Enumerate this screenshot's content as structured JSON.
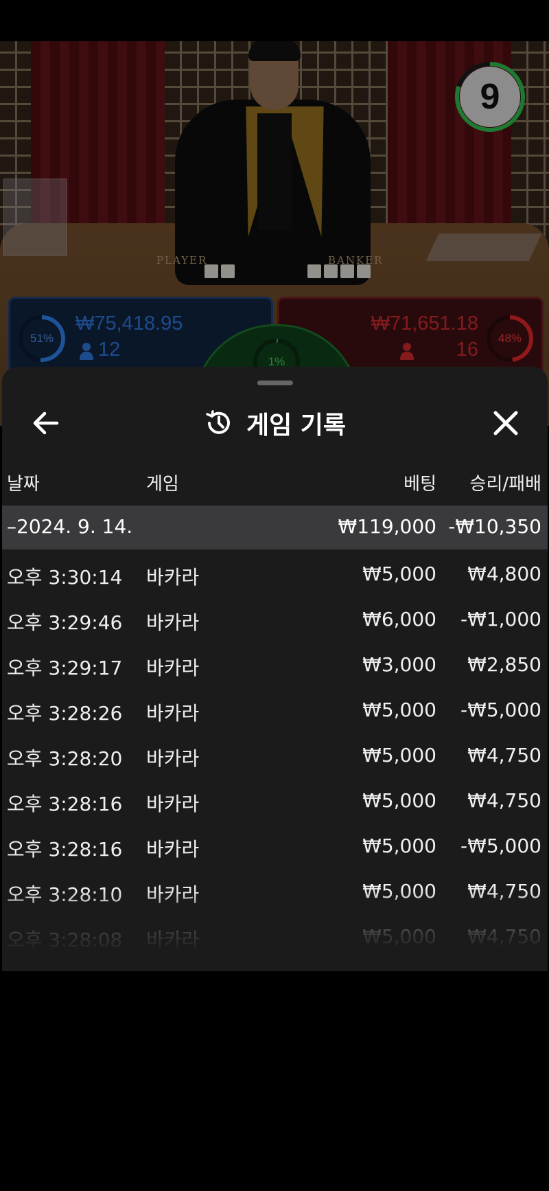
{
  "countdown": {
    "value": "9",
    "fraction_remaining": 0.8,
    "color": "#2fb34a"
  },
  "player_bet": {
    "percent": "51%",
    "amount": "₩75,418.95",
    "players": "12",
    "color": "#2d7be0"
  },
  "banker_bet": {
    "percent": "48%",
    "amount": "₩71,651.18",
    "players": "16",
    "color": "#d6262a"
  },
  "tie_bet": {
    "percent": "1%",
    "color": "#2fb34a"
  },
  "table_labels": {
    "player": "PLAYER",
    "banker": "BANKER"
  },
  "sheet": {
    "title": "게임 기록",
    "back_icon": "arrow-left-icon",
    "history_icon": "history-clock-icon",
    "close_icon": "close-icon",
    "columns": {
      "date": "날짜",
      "game": "게임",
      "bet": "베팅",
      "win_loss": "승리/패배"
    },
    "date_group": {
      "label": "–2024. 9. 14.",
      "bet_total": "₩119,000",
      "win_loss_total": "-₩10,350"
    },
    "rows": [
      {
        "time": "오후 3:30:14",
        "game": "바카라",
        "bet": "₩5,000",
        "win_loss": "₩4,800"
      },
      {
        "time": "오후 3:29:46",
        "game": "바카라",
        "bet": "₩6,000",
        "win_loss": "-₩1,000"
      },
      {
        "time": "오후 3:29:17",
        "game": "바카라",
        "bet": "₩3,000",
        "win_loss": "₩2,850"
      },
      {
        "time": "오후 3:28:26",
        "game": "바카라",
        "bet": "₩5,000",
        "win_loss": "-₩5,000"
      },
      {
        "time": "오후 3:28:20",
        "game": "바카라",
        "bet": "₩5,000",
        "win_loss": "₩4,750"
      },
      {
        "time": "오후 3:28:16",
        "game": "바카라",
        "bet": "₩5,000",
        "win_loss": "₩4,750"
      },
      {
        "time": "오후 3:28:16",
        "game": "바카라",
        "bet": "₩5,000",
        "win_loss": "-₩5,000"
      },
      {
        "time": "오후 3:28:10",
        "game": "바카라",
        "bet": "₩5,000",
        "win_loss": "₩4,750"
      },
      {
        "time": "오후 3:28:08",
        "game": "바카라",
        "bet": "₩5,000",
        "win_loss": "₩4,750"
      }
    ]
  }
}
